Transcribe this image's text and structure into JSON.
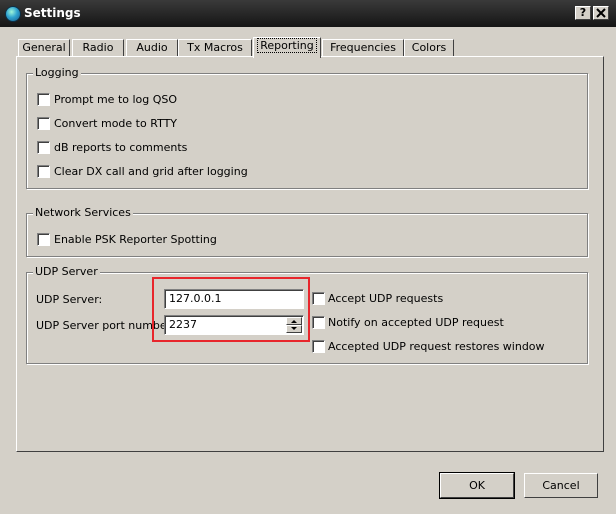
{
  "window": {
    "title": "Settings",
    "help_label": "?",
    "close_label": "X"
  },
  "tabs": [
    {
      "label": "General"
    },
    {
      "label": "Radio"
    },
    {
      "label": "Audio"
    },
    {
      "label": "Tx Macros"
    },
    {
      "label": "Reporting"
    },
    {
      "label": "Frequencies"
    },
    {
      "label": "Colors"
    }
  ],
  "active_tab": "Reporting",
  "logging": {
    "title": "Logging",
    "options": [
      {
        "label": "Prompt me to log QSO",
        "checked": false
      },
      {
        "label": "Convert mode to RTTY",
        "checked": false
      },
      {
        "label": "dB reports to comments",
        "checked": false
      },
      {
        "label": "Clear DX call and grid after logging",
        "checked": false
      }
    ]
  },
  "network": {
    "title": "Network Services",
    "options": [
      {
        "label": "Enable PSK Reporter Spotting",
        "checked": false
      }
    ]
  },
  "udp": {
    "title": "UDP Server",
    "server_label": "UDP Server:",
    "server_value": "127.0.0.1",
    "port_label": "UDP Server port number:",
    "port_value": "2237",
    "options": [
      {
        "label": "Accept UDP requests",
        "checked": false
      },
      {
        "label": "Notify on accepted UDP request",
        "checked": false
      },
      {
        "label": "Accepted UDP request restores window",
        "checked": false
      }
    ]
  },
  "buttons": {
    "ok": "OK",
    "cancel": "Cancel"
  },
  "colors": {
    "highlight": "#e8262c",
    "dialog_bg": "#d4d0c8"
  }
}
